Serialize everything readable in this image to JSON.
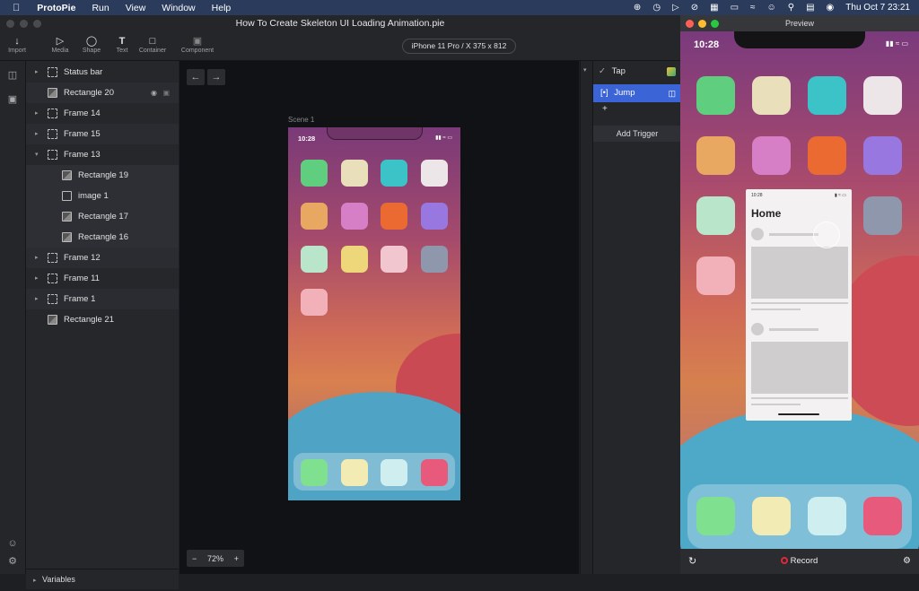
{
  "menubar": {
    "app_name": "ProtoPie",
    "menus": [
      "Run",
      "View",
      "Window",
      "Help"
    ],
    "datetime": "Thu Oct 7  23:21"
  },
  "window": {
    "title": "How To Create Skeleton UI Loading Animation.pie"
  },
  "toolbar": {
    "import": "Import",
    "media": "Media",
    "shape": "Shape",
    "text": "Text",
    "container": "Container",
    "component": "Component",
    "device": "iPhone 11 Pro / X  375 x 812"
  },
  "layers": [
    {
      "label": "Status bar",
      "kind": "frame",
      "depth": 0
    },
    {
      "label": "Rectangle 20",
      "kind": "rect",
      "depth": 0
    },
    {
      "label": "Frame 14",
      "kind": "frame",
      "depth": 0
    },
    {
      "label": "Frame 15",
      "kind": "frame",
      "depth": 0
    },
    {
      "label": "Frame 13",
      "kind": "frame",
      "depth": 0
    },
    {
      "label": "Rectangle 19",
      "kind": "rect",
      "depth": 1
    },
    {
      "label": "image 1",
      "kind": "image",
      "depth": 1
    },
    {
      "label": "Rectangle 17",
      "kind": "rect",
      "depth": 1
    },
    {
      "label": "Rectangle 16",
      "kind": "rect",
      "depth": 1
    },
    {
      "label": "Frame 12",
      "kind": "frame",
      "depth": 0
    },
    {
      "label": "Frame 11",
      "kind": "frame",
      "depth": 0
    },
    {
      "label": "Frame 1",
      "kind": "frame",
      "depth": 0
    },
    {
      "label": "Rectangle 21",
      "kind": "rect",
      "depth": 0
    }
  ],
  "variables_label": "Variables",
  "canvas": {
    "scene_label": "Scene 1",
    "zoom": "72%",
    "phone_time": "10:28"
  },
  "interactions": {
    "trigger": "Tap",
    "response": "Jump",
    "add_trigger": "Add Trigger"
  },
  "preview": {
    "title": "Preview",
    "time": "10:28",
    "skeleton_title": "Home",
    "skeleton_time": "10:28",
    "record_label": "Record"
  },
  "colors": {
    "app_icons": [
      "#5fcf7f",
      "#e9e0bb",
      "#3cc3c8",
      "#ece6e8",
      "#e9a862",
      "#d77fc6",
      "#ea6a32",
      "#9878e0",
      "#b9e6cb",
      "#eed77a",
      "#f2c6cf",
      "#8e97ab",
      "#f2b0b8"
    ],
    "dock_icons": [
      "#7fe08f",
      "#f3ebb4",
      "#cfeef0",
      "#e85a7c"
    ],
    "accent_blue": "#3b64d6",
    "record_red": "#e0263a"
  }
}
